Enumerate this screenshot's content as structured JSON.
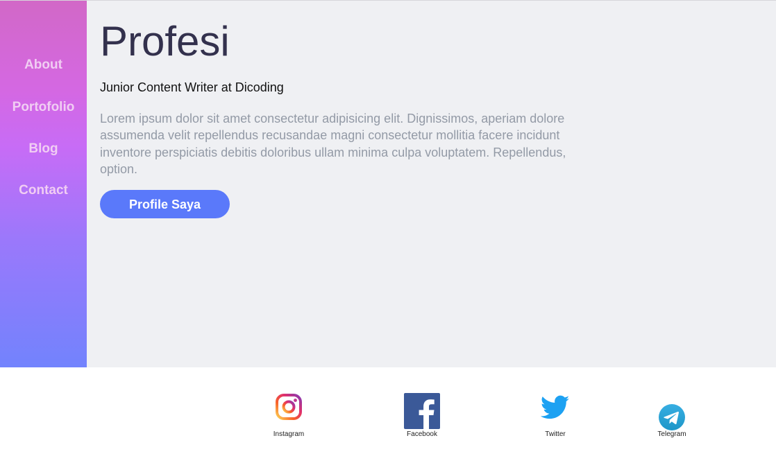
{
  "nav": {
    "items": [
      {
        "label": "About"
      },
      {
        "label": "Portofolio"
      },
      {
        "label": "Blog"
      },
      {
        "label": "Contact"
      }
    ]
  },
  "main": {
    "title": "Profesi",
    "job": "Junior Content Writer at Dicoding",
    "description": "Lorem ipsum dolor sit amet consectetur adipisicing elit. Dignissimos, aperiam dolore assumenda velit repellendus recusandae magni consectetur mollitia facere incidunt inventore perspiciatis debitis doloribus ullam minima culpa voluptatem. Repellendus, option.",
    "button_label": "Profile Saya"
  },
  "social": [
    {
      "label": "Instagram",
      "icon": "instagram-icon"
    },
    {
      "label": "Facebook",
      "icon": "facebook-icon"
    },
    {
      "label": "Twitter",
      "icon": "twitter-icon"
    },
    {
      "label": "Telegram",
      "icon": "telegram-icon"
    }
  ],
  "colors": {
    "sidebar_gradient": [
      "#d268c7",
      "#d468e3",
      "#c76cf6",
      "#9b78fb",
      "#7283fd"
    ],
    "nav_text": "#f1cdf3",
    "main_bg": "#eff0f3",
    "title": "#33314d",
    "description": "#939aa6",
    "button": "#5a79fa",
    "facebook": "#3b5998",
    "twitter": "#1da1f2",
    "telegram": "#2aa3e0"
  }
}
